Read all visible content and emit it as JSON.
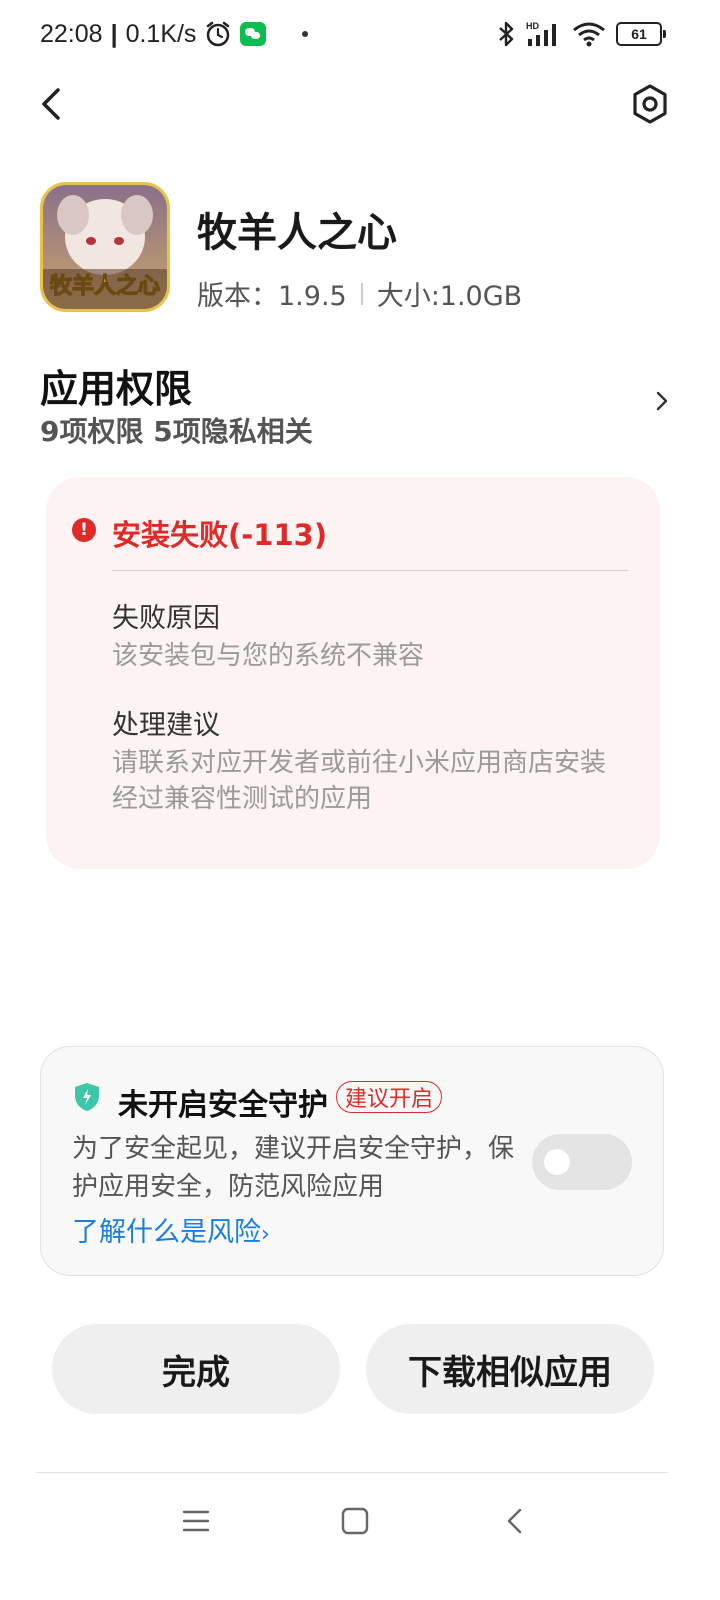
{
  "status_bar": {
    "time": "22:08",
    "speed": "0.1K/s",
    "battery": "61",
    "network": "HD"
  },
  "app": {
    "name": "牧羊人之心",
    "icon_text": "牧羊人之心",
    "version": "版本：1.9.5",
    "size": "大小:1.0GB"
  },
  "permissions": {
    "title": "应用权限",
    "subtitle": "9项权限 5项隐私相关"
  },
  "error": {
    "title": "安装失败(-113)",
    "reason_label": "失败原因",
    "reason_text": "该安装包与您的系统不兼容",
    "advice_label": "处理建议",
    "advice_text": "请联系对应开发者或前往小米应用商店安装经过兼容性测试的应用"
  },
  "safety": {
    "title": "未开启安全守护",
    "badge": "建议开启",
    "description": "为了安全起见，建议开启安全守护，保护应用安全，防范风险应用",
    "link": "了解什么是风险",
    "toggle_on": false
  },
  "buttons": {
    "done": "完成",
    "download_similar": "下载相似应用"
  },
  "colors": {
    "error_red": "#e02a2a",
    "link_blue": "#1a7ee0",
    "shield_green": "#3ec6a8"
  }
}
